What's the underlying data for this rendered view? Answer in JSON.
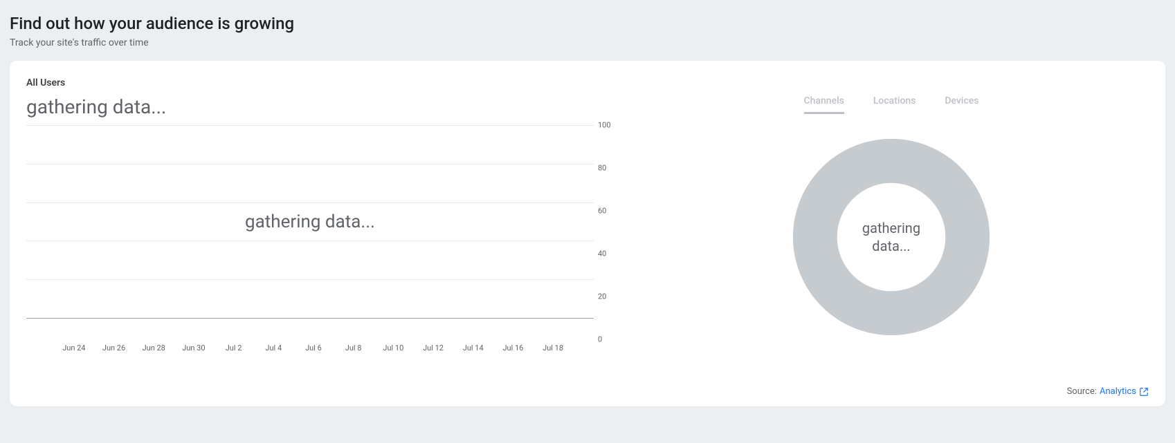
{
  "header": {
    "title": "Find out how your audience is growing",
    "subtitle": "Track your site's traffic over time"
  },
  "card": {
    "section_title": "All Users",
    "loading_big": "gathering data...",
    "loading_overlay": "gathering data...",
    "donut_loading": "gathering data...",
    "tabs": {
      "channels": "Channels",
      "locations": "Locations",
      "devices": "Devices"
    },
    "source_prefix": "Source: ",
    "source_link": "Analytics"
  },
  "chart_data": [
    {
      "type": "line",
      "title": "All Users",
      "status": "gathering data...",
      "categories": [
        "Jun 24",
        "Jun 26",
        "Jun 28",
        "Jun 30",
        "Jul 2",
        "Jul 4",
        "Jul 6",
        "Jul 8",
        "Jul 10",
        "Jul 12",
        "Jul 14",
        "Jul 16",
        "Jul 18"
      ],
      "series": [
        {
          "name": "Users",
          "values": [
            null,
            null,
            null,
            null,
            null,
            null,
            null,
            null,
            null,
            null,
            null,
            null,
            null
          ]
        }
      ],
      "xlabel": "",
      "ylabel": "",
      "ylim": [
        0,
        100
      ],
      "yticks": [
        0,
        20,
        40,
        60,
        80,
        100
      ],
      "grid": true
    },
    {
      "type": "pie",
      "subtype": "donut",
      "title": "Channels",
      "status": "gathering data...",
      "series": [],
      "values": []
    }
  ]
}
